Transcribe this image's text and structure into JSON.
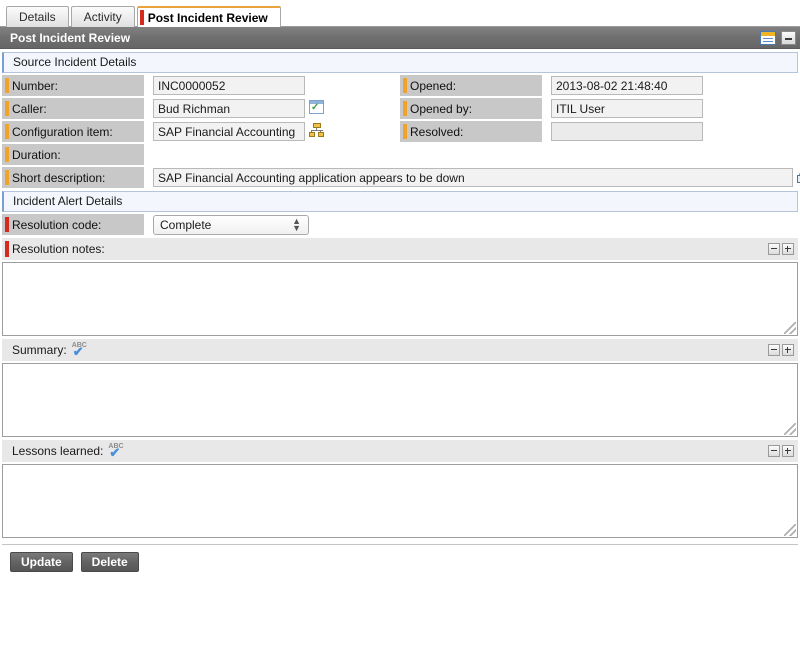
{
  "tabs": [
    {
      "label": "Details",
      "active": false
    },
    {
      "label": "Activity",
      "active": false
    },
    {
      "label": "Post Incident Review",
      "active": true
    }
  ],
  "titlebar": {
    "title": "Post Incident Review",
    "listview_icon": "list-view-icon",
    "minimize_icon": "minimize-icon"
  },
  "sections": {
    "source_incident": "Source Incident Details",
    "incident_alert": "Incident Alert Details"
  },
  "fields": {
    "number": {
      "label": "Number:",
      "value": "INC0000052"
    },
    "opened": {
      "label": "Opened:",
      "value": "2013-08-02 21:48:40"
    },
    "caller": {
      "label": "Caller:",
      "value": "Bud Richman",
      "icon": "preview-record-icon"
    },
    "opened_by": {
      "label": "Opened by:",
      "value": "ITIL User"
    },
    "configuration_item": {
      "label": "Configuration item:",
      "value": "SAP Financial Accounting",
      "icon": "ci-relations-icon"
    },
    "resolved": {
      "label": "Resolved:",
      "value": ""
    },
    "duration": {
      "label": "Duration:",
      "value": ""
    },
    "short_description": {
      "label": "Short description:",
      "value": "SAP Financial Accounting application appears to be down",
      "icon": "knowledge-search-icon"
    },
    "resolution_code": {
      "label": "Resolution code:",
      "value": "Complete",
      "options": [
        "Complete"
      ]
    }
  },
  "textareas": {
    "resolution_notes": {
      "label": "Resolution notes:",
      "value": "",
      "collapse_icon": "collapse-icon",
      "expand_icon": "expand-icon"
    },
    "summary": {
      "label": "Summary:",
      "value": "",
      "spell_icon": "spellcheck-icon",
      "collapse_icon": "collapse-icon",
      "expand_icon": "expand-icon"
    },
    "lessons_learned": {
      "label": "Lessons learned:",
      "value": "",
      "spell_icon": "spellcheck-icon",
      "collapse_icon": "collapse-icon",
      "expand_icon": "expand-icon"
    }
  },
  "footer": {
    "update_label": "Update",
    "delete_label": "Delete"
  },
  "colors": {
    "mandatory_orange": "#f0a32a",
    "mandatory_red": "#d42b1e",
    "active_tab_top": "#e8a33d",
    "titlebar": "#6f6f6f",
    "label_bg": "#c8c8c8",
    "section_bg": "#f3f6fc"
  }
}
